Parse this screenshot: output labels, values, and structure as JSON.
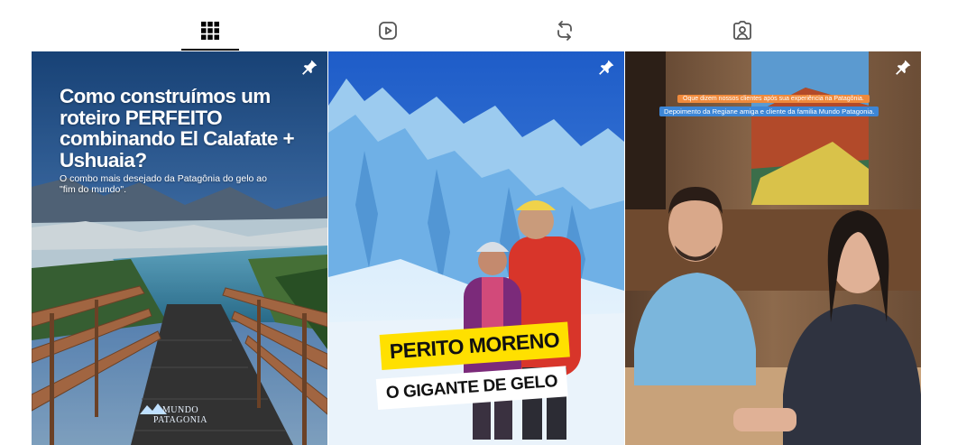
{
  "tabs": [
    {
      "name": "posts",
      "icon": "grid-icon",
      "active": true
    },
    {
      "name": "reels",
      "icon": "reels-play-icon",
      "active": false
    },
    {
      "name": "reposts",
      "icon": "repost-icon",
      "active": false
    },
    {
      "name": "tagged",
      "icon": "tagged-user-icon",
      "active": false
    }
  ],
  "posts": [
    {
      "pinned": true,
      "title": "Como construímos um roteiro PERFEITO combinando El Calafate + Ushuaia?",
      "subtitle": "O combo mais desejado da Patagônia  do gelo ao \"fim do mundo\".",
      "logo_text": "MUNDO PATAGONIA"
    },
    {
      "pinned": true,
      "banner_line1": "PERITO MORENO",
      "banner_line2": "O GIGANTE DE GELO"
    },
    {
      "pinned": true,
      "caption_line1": "Oque dizem nossos clientes após sua experiência na Patagônia.",
      "caption_line2": "Depoimento da Regiane amiga e cliente da familia Mundo Patagonia."
    }
  ],
  "colors": {
    "yellow_banner": "#ffe000",
    "caption_orange": "#f08a3c",
    "caption_blue": "#3d86d6"
  }
}
